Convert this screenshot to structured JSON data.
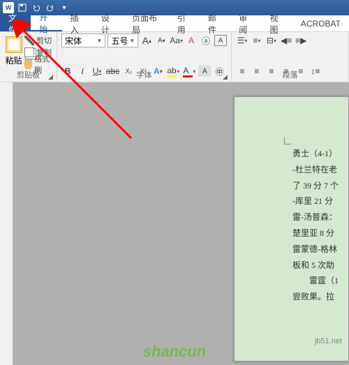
{
  "titlebar": {
    "app_letter": "W"
  },
  "tabs": {
    "file": "文件",
    "home": "开始",
    "insert": "插入",
    "design": "设计",
    "layout": "页面布局",
    "references": "引用",
    "mail": "邮件",
    "review": "审阅",
    "view": "视图",
    "acrobat": "ACROBAT"
  },
  "clipboard": {
    "paste": "粘贴",
    "cut": "剪切",
    "copy": "复制",
    "format_painter": "格式刷",
    "group_label": "剪贴板"
  },
  "font": {
    "name": "宋体",
    "size": "五号",
    "grow": "A",
    "shrink": "A",
    "case": "Aa",
    "clear": "A",
    "bold": "B",
    "italic": "I",
    "underline": "U",
    "strike": "abc",
    "sub": "X₂",
    "sup": "X²",
    "effects": "A",
    "highlight": "ab",
    "color": "A",
    "phonetic": "A",
    "border": "A",
    "group_label": "字体"
  },
  "paragraph": {
    "group_label": "段落"
  },
  "document": {
    "lines": [
      "勇士（4-1）",
      "-杜兰特在老",
      "了 39 分 7 个",
      "-库里 21 分",
      "雷-汤普森：",
      "楚里亚 8 分",
      "雷蒙德-格林",
      "板和 5 次助",
      "",
      "　　雷霆（1",
      "尝败果。拉"
    ]
  },
  "watermark": {
    "main": "shancun",
    "sub": "jb51.net"
  }
}
